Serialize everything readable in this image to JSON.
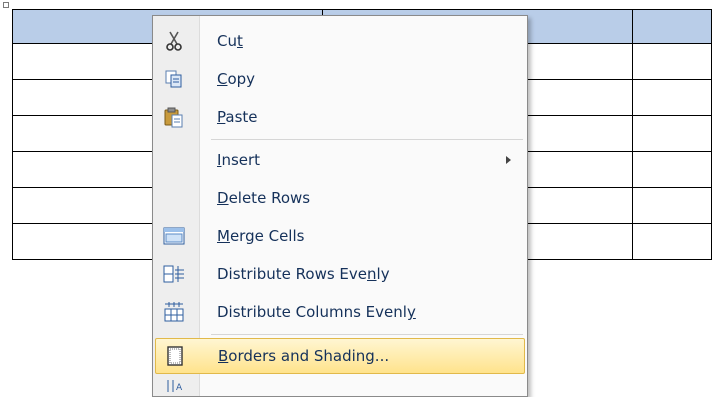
{
  "table": {
    "rows": 7,
    "columns": 3,
    "selected_row": 0,
    "selection_color": "#b9cde8"
  },
  "context_menu": {
    "items": [
      {
        "id": "cut",
        "icon": "scissors-icon",
        "pre": "Cu",
        "acc": "t",
        "post": ""
      },
      {
        "id": "copy",
        "icon": "copy-icon",
        "pre": "",
        "acc": "C",
        "post": "opy"
      },
      {
        "id": "paste",
        "icon": "clipboard-icon",
        "pre": "",
        "acc": "P",
        "post": "aste"
      },
      {
        "id": "insert",
        "icon": "",
        "pre": "",
        "acc": "I",
        "post": "nsert",
        "submenu": true
      },
      {
        "id": "delete-rows",
        "icon": "",
        "pre": "",
        "acc": "D",
        "post": "elete Rows"
      },
      {
        "id": "merge-cells",
        "icon": "merge-cells-icon",
        "pre": "",
        "acc": "M",
        "post": "erge Cells"
      },
      {
        "id": "distribute-rows",
        "icon": "distribute-rows-icon",
        "pre": "Distribute Rows Eve",
        "acc": "n",
        "post": "ly"
      },
      {
        "id": "distribute-columns",
        "icon": "distribute-columns-icon",
        "pre": "Distribute Columns Evenl",
        "acc": "y",
        "post": ""
      },
      {
        "id": "borders-shading",
        "icon": "borders-icon",
        "pre": "",
        "acc": "B",
        "post": "orders and Shading...",
        "highlighted": true
      }
    ],
    "highlight_color": "#ffe38c"
  }
}
